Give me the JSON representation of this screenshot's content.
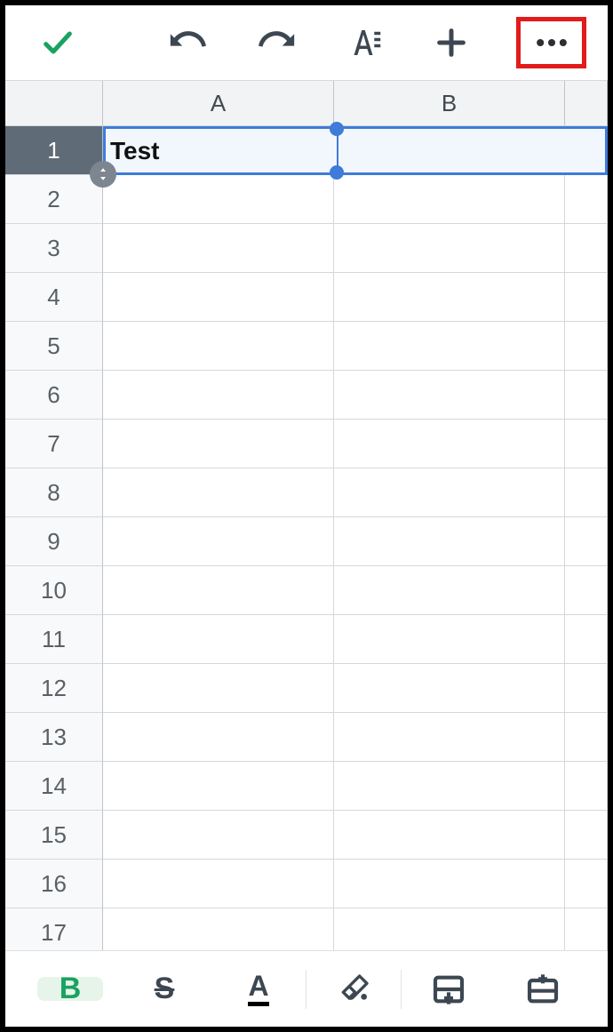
{
  "toolbar_top": {
    "icons": {
      "accept": "check-icon",
      "undo": "undo-icon",
      "redo": "redo-icon",
      "format": "text-format-icon",
      "add": "plus-icon",
      "more": "more-horizontal-icon"
    }
  },
  "columns": [
    "A",
    "B"
  ],
  "rows": [
    1,
    2,
    3,
    4,
    5,
    6,
    7,
    8,
    9,
    10,
    11,
    12,
    13,
    14,
    15,
    16,
    17
  ],
  "selection": {
    "active_cell": "A1",
    "range": "A1:C1",
    "value": "Test"
  },
  "cells": {
    "A1": "Test"
  },
  "toolbar_bottom": {
    "bold_label": "B",
    "strike_label": "S",
    "textcolor_label": "A",
    "icons": {
      "bold": "bold-icon",
      "strike": "strikethrough-icon",
      "textcolor": "text-color-icon",
      "fillcolor": "fill-color-icon",
      "cellborder": "cell-format-icon",
      "insertcell": "insert-cell-icon"
    }
  },
  "colors": {
    "accent_green": "#1aa260",
    "selection_blue": "#3f7bd9",
    "highlight_red": "#e21b1b"
  }
}
